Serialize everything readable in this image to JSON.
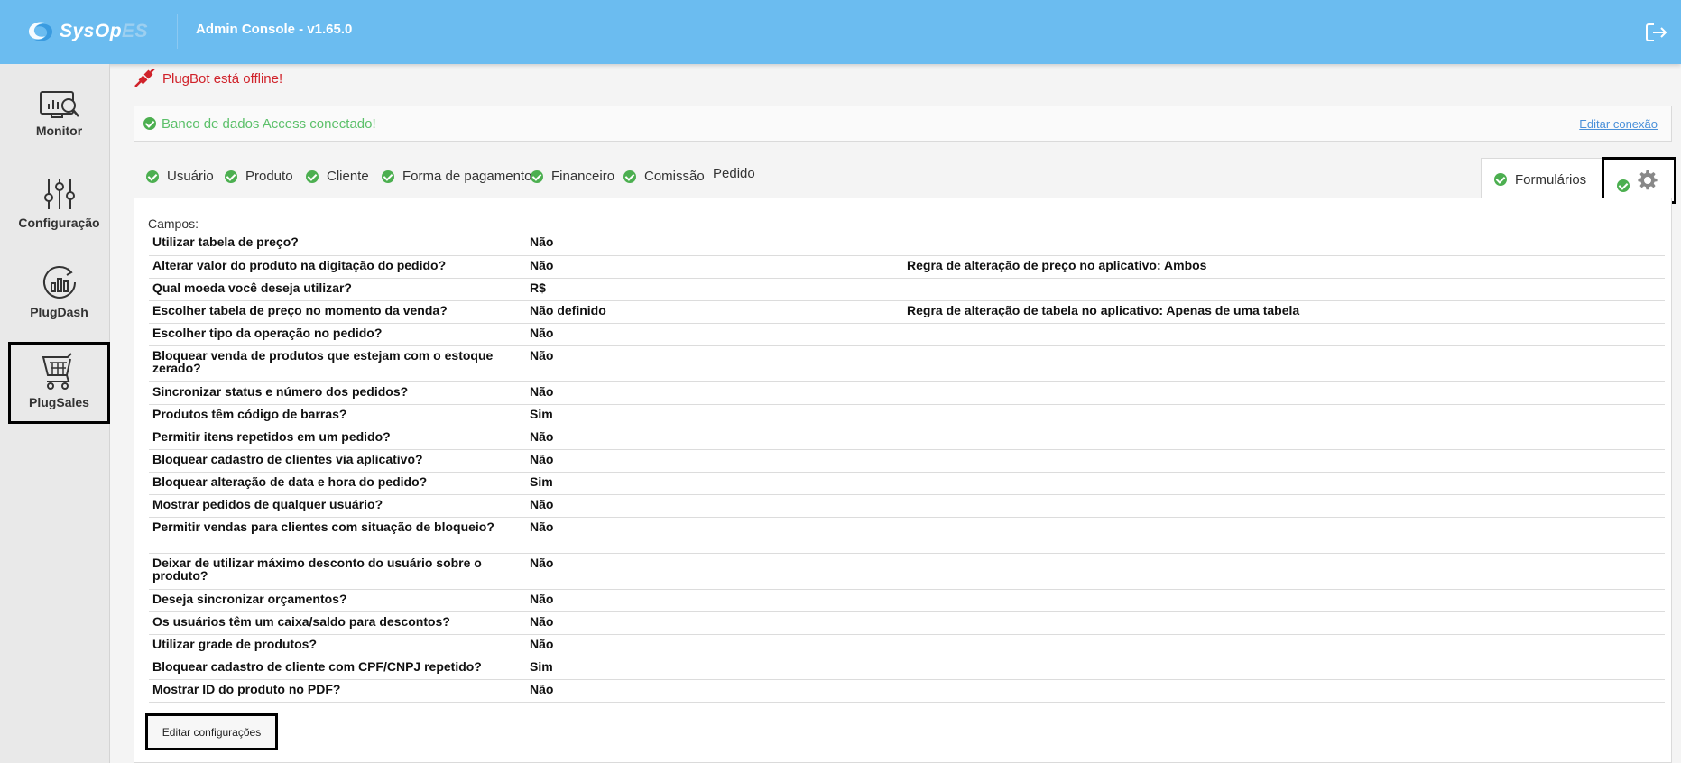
{
  "header": {
    "logo_text_main": "SysOp",
    "logo_text_suffix": "ES",
    "app_title": "Admin Console - v1.65.0"
  },
  "sidebar": {
    "items": [
      {
        "label": "Monitor",
        "icon": "monitor-chart-icon"
      },
      {
        "label": "Configuração",
        "icon": "sliders-icon"
      },
      {
        "label": "PlugDash",
        "icon": "dashboard-chart-icon"
      },
      {
        "label": "PlugSales",
        "icon": "shopping-cart-icon",
        "active": true
      }
    ]
  },
  "status": {
    "plugbot_offline": "PlugBot está offline!",
    "db_connected": "Banco de dados Access conectado!",
    "edit_connection": "Editar conexão"
  },
  "tabs": [
    {
      "label": "Usuário",
      "checked": true
    },
    {
      "label": "Produto",
      "checked": true
    },
    {
      "label": "Cliente",
      "checked": true
    },
    {
      "label": "Forma de pagamento",
      "checked": true
    },
    {
      "label": "Financeiro",
      "checked": true
    },
    {
      "label": "Comissão",
      "checked": true
    },
    {
      "label": "Pedido",
      "checked": false
    }
  ],
  "right_tab": {
    "label": "Formulários"
  },
  "content": {
    "campos_label": "Campos:",
    "rows": [
      {
        "q": "Utilizar tabela de preço?",
        "v": "Não",
        "extra": ""
      },
      {
        "q": "Alterar valor do produto na digitação do pedido?",
        "v": "Não",
        "extra": "Regra de alteração de preço no aplicativo: Ambos"
      },
      {
        "q": "Qual moeda você deseja utilizar?",
        "v": "R$",
        "extra": ""
      },
      {
        "q": "Escolher tabela de preço no momento da venda?",
        "v": "Não definido",
        "extra": "Regra de alteração de tabela no aplicativo: Apenas de uma tabela"
      },
      {
        "q": "Escolher tipo da operação no pedido?",
        "v": "Não",
        "extra": ""
      },
      {
        "q": "Bloquear venda de produtos que estejam com o estoque zerado?",
        "v": "Não",
        "extra": ""
      },
      {
        "q": "Sincronizar status e número dos pedidos?",
        "v": "Não",
        "extra": ""
      },
      {
        "q": "Produtos têm código de barras?",
        "v": "Sim",
        "extra": ""
      },
      {
        "q": "Permitir itens repetidos em um pedido?",
        "v": "Não",
        "extra": ""
      },
      {
        "q": "Bloquear cadastro de clientes via aplicativo?",
        "v": "Não",
        "extra": ""
      },
      {
        "q": "Bloquear alteração de data e hora do pedido?",
        "v": "Sim",
        "extra": ""
      },
      {
        "q": "Mostrar pedidos de qualquer usuário?",
        "v": "Não",
        "extra": ""
      },
      {
        "q": "Permitir vendas para clientes com situação de bloqueio?",
        "v": "Não",
        "extra": ""
      },
      {
        "q": "Deixar de utilizar máximo desconto do usuário sobre o produto?",
        "v": "Não",
        "extra": ""
      },
      {
        "q": "Deseja sincronizar orçamentos?",
        "v": "Não",
        "extra": ""
      },
      {
        "q": "Os usuários têm um caixa/saldo para descontos?",
        "v": "Não",
        "extra": ""
      },
      {
        "q": "Utilizar grade de produtos?",
        "v": "Não",
        "extra": ""
      },
      {
        "q": "Bloquear cadastro de cliente com CPF/CNPJ repetido?",
        "v": "Sim",
        "extra": ""
      },
      {
        "q": "Mostrar ID do produto no PDF?",
        "v": "Não",
        "extra": ""
      }
    ],
    "edit_button": "Editar configurações"
  },
  "colors": {
    "header": "#6bbcf0",
    "ok_green": "#4caf50",
    "offline_red": "#d0222a",
    "link_blue": "#4a90d9"
  }
}
